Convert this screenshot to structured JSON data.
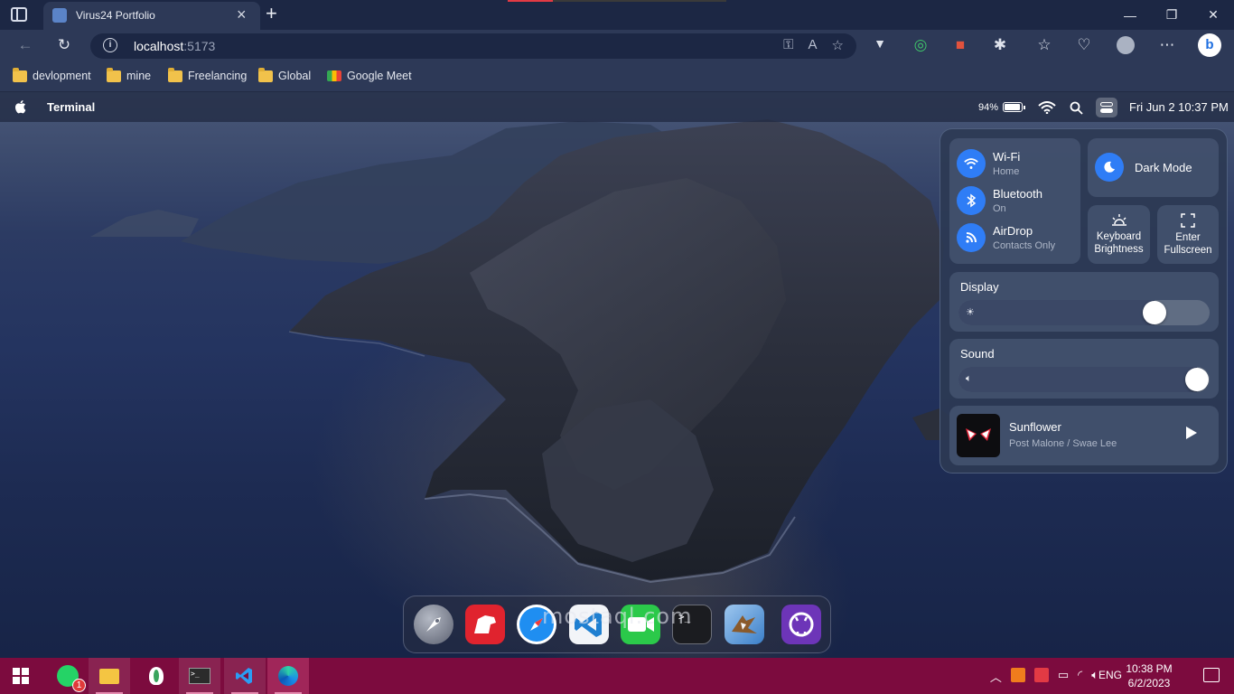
{
  "browser": {
    "tab_title": "Virus24 Portfolio",
    "url_host": "localhost",
    "url_port": ":5173",
    "bookmarks": [
      {
        "label": "devlopment",
        "icon": "folder-icon"
      },
      {
        "label": "mine",
        "icon": "folder-icon"
      },
      {
        "label": "Freelancing",
        "icon": "folder-icon"
      },
      {
        "label": "Global",
        "icon": "folder-icon"
      },
      {
        "label": "Google Meet",
        "icon": "google-meet-icon"
      }
    ]
  },
  "menubar": {
    "app_name": "Terminal",
    "battery_percent": "94%",
    "battery_level": 0.94,
    "datetime": "Fri Jun 2 10:37 PM"
  },
  "control_center": {
    "connectivity": [
      {
        "title": "Wi-Fi",
        "subtitle": "Home",
        "icon": "wifi-icon"
      },
      {
        "title": "Bluetooth",
        "subtitle": "On",
        "icon": "bluetooth-icon"
      },
      {
        "title": "AirDrop",
        "subtitle": "Contacts Only",
        "icon": "airdrop-icon"
      }
    ],
    "dark_mode_label": "Dark Mode",
    "keyboard_brightness_label": "Keyboard Brightness",
    "fullscreen_label": "Enter Fullscreen",
    "display_label": "Display",
    "display_level": 0.78,
    "sound_label": "Sound",
    "sound_level": 0.95,
    "now_playing": {
      "title": "Sunflower",
      "artist": "Post Malone / Swae Lee"
    }
  },
  "dock": {
    "apps": [
      "launchpad-icon",
      "bear-notes-icon",
      "safari-icon",
      "vscode-icon",
      "facetime-icon",
      "terminal-icon",
      "mail-icon",
      "github-icon"
    ]
  },
  "watermark": "mostaql.com",
  "taskbar": {
    "whatsapp_badge": "1",
    "lang": "ENG",
    "time": "10:38 PM",
    "date": "6/2/2023"
  },
  "colors": {
    "accent_blue": "#2f7df6",
    "taskbar": "#7c0b3e",
    "browser_chrome": "#2d3957"
  }
}
